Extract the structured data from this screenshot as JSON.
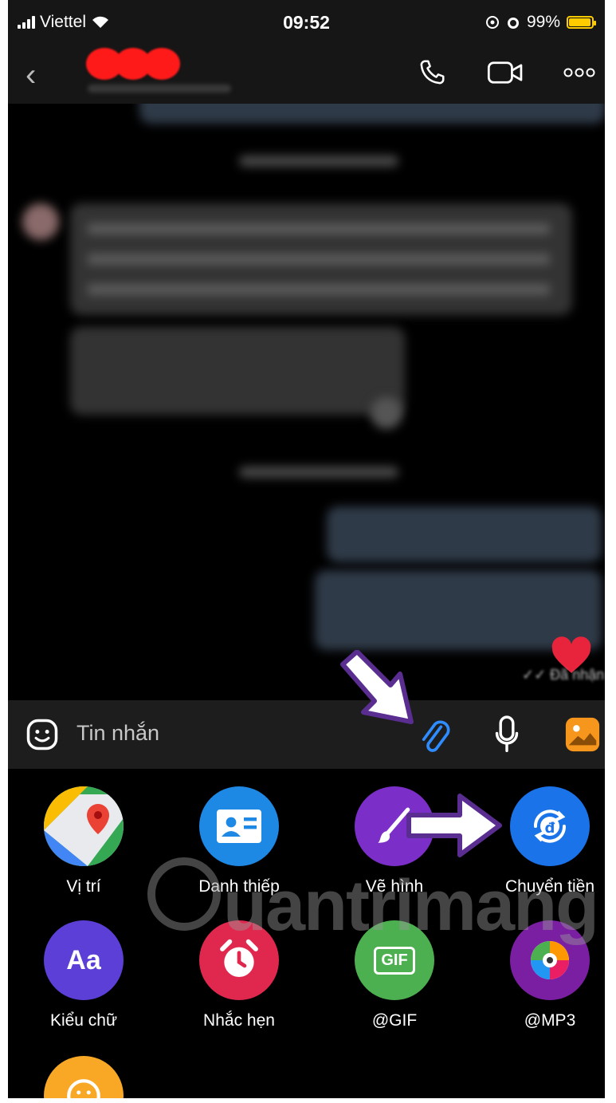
{
  "status_bar": {
    "carrier": "Viettel",
    "time": "09:52",
    "battery": "99%"
  },
  "chat": {
    "seen_label": "Đã nhận"
  },
  "input": {
    "placeholder": "Tin nhắn"
  },
  "attachments": [
    {
      "label": "Vị trí",
      "icon": "map-pin-icon",
      "color": "#ffffff"
    },
    {
      "label": "Danh thiếp",
      "icon": "contact-card-icon",
      "color": "#1e88e5"
    },
    {
      "label": "Vẽ hình",
      "icon": "brush-icon",
      "color": "#7b2fc8"
    },
    {
      "label": "Chuyển tiền",
      "icon": "money-transfer-icon",
      "color": "#1a73e8"
    },
    {
      "label": "Kiểu chữ",
      "icon": "font-style-icon",
      "color": "#5b3fd6"
    },
    {
      "label": "Nhắc hẹn",
      "icon": "alarm-clock-icon",
      "color": "#e0284f"
    },
    {
      "label": "@GIF",
      "icon": "gif-icon",
      "color": "#4caf50"
    },
    {
      "label": "@MP3",
      "icon": "music-disc-icon",
      "color": "#7b1fa2"
    },
    {
      "label": "",
      "icon": "sticker-icon",
      "color": "#f9a825"
    }
  ],
  "aa_text": "Aa",
  "gif_text": "GIF",
  "watermark": "uantrimang",
  "colors": {
    "accent": "#1a73e8",
    "arrow": "#ffffff",
    "arrow_outline": "#5a2d91"
  }
}
